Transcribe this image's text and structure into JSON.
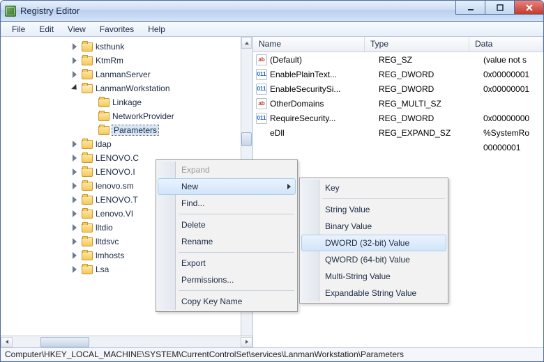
{
  "window": {
    "title": "Registry Editor"
  },
  "menubar": [
    "File",
    "Edit",
    "View",
    "Favorites",
    "Help"
  ],
  "tree": {
    "items": [
      {
        "indent": 100,
        "twisty": "closed",
        "label": "ksthunk"
      },
      {
        "indent": 100,
        "twisty": "closed",
        "label": "KtmRm"
      },
      {
        "indent": 100,
        "twisty": "closed",
        "label": "LanmanServer"
      },
      {
        "indent": 100,
        "twisty": "open",
        "label": "LanmanWorkstation",
        "open": true
      },
      {
        "indent": 124,
        "twisty": "none",
        "label": "Linkage"
      },
      {
        "indent": 124,
        "twisty": "none",
        "label": "NetworkProvider"
      },
      {
        "indent": 124,
        "twisty": "none",
        "label": "Parameters",
        "selected": true
      },
      {
        "indent": 100,
        "twisty": "closed",
        "label": "ldap"
      },
      {
        "indent": 100,
        "twisty": "closed",
        "label": "LENOVO.C"
      },
      {
        "indent": 100,
        "twisty": "closed",
        "label": "LENOVO.I"
      },
      {
        "indent": 100,
        "twisty": "closed",
        "label": "lenovo.sm"
      },
      {
        "indent": 100,
        "twisty": "closed",
        "label": "LENOVO.T"
      },
      {
        "indent": 100,
        "twisty": "closed",
        "label": "Lenovo.VI"
      },
      {
        "indent": 100,
        "twisty": "closed",
        "label": "lltdio"
      },
      {
        "indent": 100,
        "twisty": "closed",
        "label": "lltdsvc"
      },
      {
        "indent": 100,
        "twisty": "closed",
        "label": "lmhosts"
      },
      {
        "indent": 100,
        "twisty": "closed",
        "label": "Lsa"
      }
    ]
  },
  "list": {
    "columns": {
      "name": "Name",
      "type": "Type",
      "data": "Data"
    },
    "rows": [
      {
        "icon": "sz",
        "name": "(Default)",
        "type": "REG_SZ",
        "data": "(value not s"
      },
      {
        "icon": "dw",
        "name": "EnablePlainText...",
        "type": "REG_DWORD",
        "data": "0x00000001"
      },
      {
        "icon": "dw",
        "name": "EnableSecuritySi...",
        "type": "REG_DWORD",
        "data": "0x00000001"
      },
      {
        "icon": "sz",
        "name": "OtherDomains",
        "type": "REG_MULTI_SZ",
        "data": ""
      },
      {
        "icon": "dw",
        "name": "RequireSecurity...",
        "type": "REG_DWORD",
        "data": "0x00000000"
      },
      {
        "icon": "",
        "name": "eDll",
        "type": "REG_EXPAND_SZ",
        "data": "%SystemRo"
      },
      {
        "icon": "",
        "name": "",
        "type": "",
        "data": "00000001"
      }
    ]
  },
  "context_menu_1": {
    "items": [
      {
        "label": "Expand",
        "disabled": true
      },
      {
        "label": "New",
        "hover": true,
        "submenu": true
      },
      {
        "label": "Find..."
      },
      {
        "sep": true
      },
      {
        "label": "Delete"
      },
      {
        "label": "Rename"
      },
      {
        "sep": true
      },
      {
        "label": "Export"
      },
      {
        "label": "Permissions..."
      },
      {
        "sep": true
      },
      {
        "label": "Copy Key Name"
      }
    ]
  },
  "context_menu_2": {
    "items": [
      {
        "label": "Key"
      },
      {
        "sep": true
      },
      {
        "label": "String Value"
      },
      {
        "label": "Binary Value"
      },
      {
        "label": "DWORD (32-bit) Value",
        "hover": true
      },
      {
        "label": "QWORD (64-bit) Value"
      },
      {
        "label": "Multi-String Value"
      },
      {
        "label": "Expandable String Value"
      }
    ]
  },
  "statusbar": "Computer\\HKEY_LOCAL_MACHINE\\SYSTEM\\CurrentControlSet\\services\\LanmanWorkstation\\Parameters"
}
